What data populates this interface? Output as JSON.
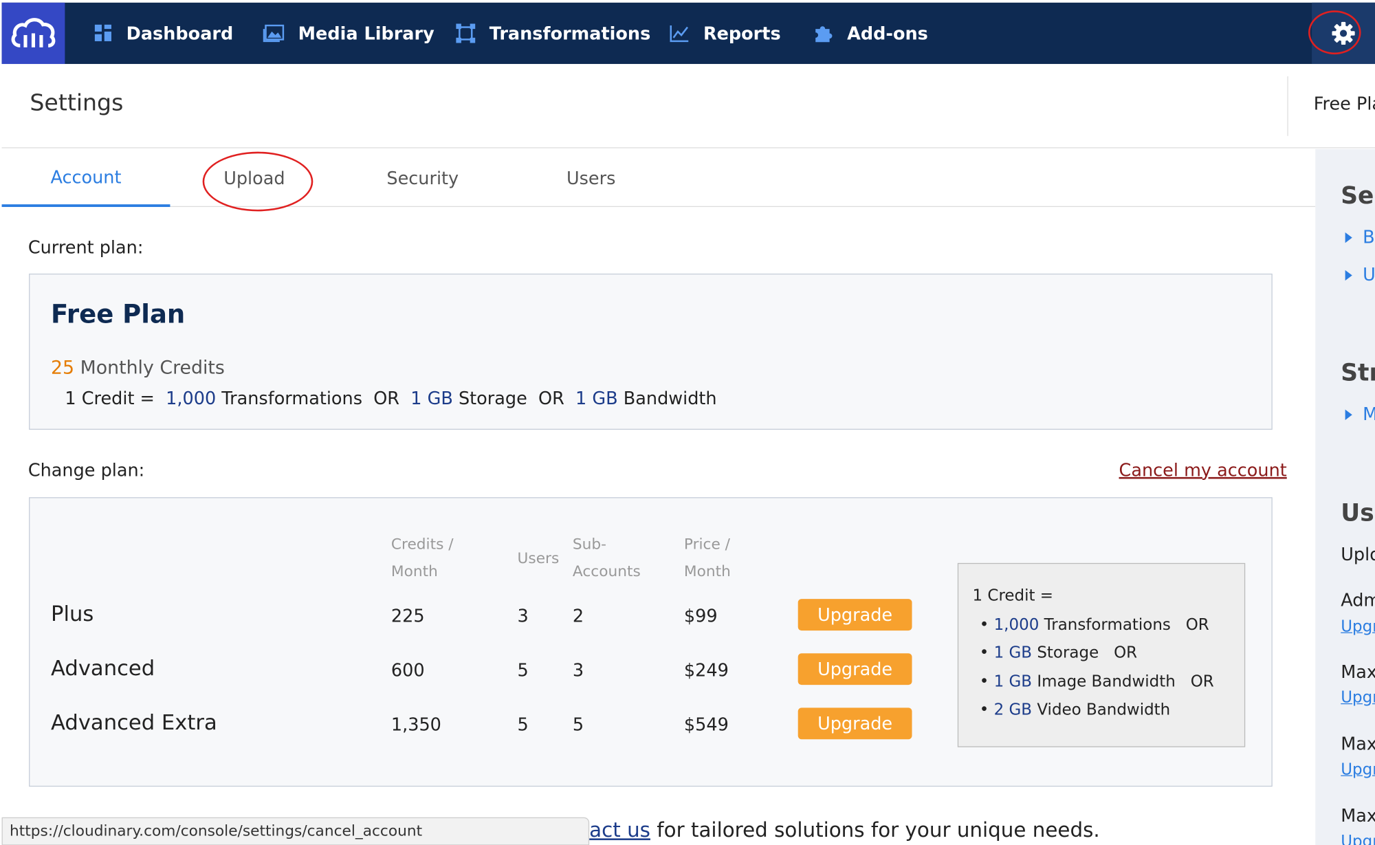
{
  "nav": {
    "items": [
      {
        "label": "Dashboard",
        "icon": "grid-icon"
      },
      {
        "label": "Media Library",
        "icon": "image-icon"
      },
      {
        "label": "Transformations",
        "icon": "crop-icon"
      },
      {
        "label": "Reports",
        "icon": "chart-icon"
      },
      {
        "label": "Add-ons",
        "icon": "puzzle-icon"
      }
    ],
    "settings_icon": "gear-icon"
  },
  "header": {
    "title": "Settings",
    "plan_label": "Free Pla"
  },
  "tabs": [
    "Account",
    "Upload",
    "Security",
    "Users"
  ],
  "current_plan": {
    "section_label": "Current plan:",
    "name": "Free Plan",
    "credits_value": "25",
    "credits_label": "Monthly Credits",
    "eq_prefix": "1 Credit =",
    "eq_trans_value": "1,000",
    "eq_trans_label": "Transformations",
    "or": "OR",
    "eq_storage_value": "1 GB",
    "eq_storage_label": "Storage",
    "eq_bw_value": "1 GB",
    "eq_bw_label": "Bandwidth"
  },
  "change_plan": {
    "section_label": "Change plan:",
    "cancel_link": "Cancel my account",
    "headers": {
      "credits": [
        "Credits /",
        "Month"
      ],
      "users": "Users",
      "subaccounts": [
        "Sub-",
        "Accounts"
      ],
      "price": [
        "Price /",
        "Month"
      ]
    },
    "rows": [
      {
        "name": "Plus",
        "credits": "225",
        "users": "3",
        "subaccounts": "2",
        "price": "$99",
        "button": "Upgrade"
      },
      {
        "name": "Advanced",
        "credits": "600",
        "users": "5",
        "subaccounts": "3",
        "price": "$249",
        "button": "Upgrade"
      },
      {
        "name": "Advanced Extra",
        "credits": "1,350",
        "users": "5",
        "subaccounts": "5",
        "price": "$549",
        "button": "Upgrade"
      }
    ],
    "credit_box": {
      "title": "1 Credit =",
      "items": [
        {
          "value": "1,000",
          "label": "Transformations",
          "suffix": "OR"
        },
        {
          "value": "1 GB",
          "label": "Storage",
          "suffix": "OR"
        },
        {
          "value": "1 GB",
          "label": "Image Bandwidth",
          "suffix": "OR"
        },
        {
          "value": "2 GB",
          "label": "Video Bandwidth",
          "suffix": ""
        }
      ]
    }
  },
  "right_panel": {
    "heading1": "Sel",
    "links1": [
      "B",
      "U"
    ],
    "heading2": "Str",
    "links2": [
      "M"
    ],
    "heading3": "Usa",
    "items": [
      {
        "label": "Uplo",
        "link": ""
      },
      {
        "label": "Adm",
        "link": "Upgr"
      },
      {
        "label": "Max",
        "link": "Upgr"
      },
      {
        "label": "Max",
        "link": "Upgr"
      },
      {
        "label": "Max",
        "link": "Upgr"
      }
    ]
  },
  "status_bar_url": "https://cloudinary.com/console/settings/cancel_account",
  "footer": {
    "link": "act us",
    "text": " for tailored solutions for your unique needs."
  },
  "colors": {
    "nav_bg": "#0e2a52",
    "logo_bg": "#3448c5",
    "accent_blue": "#2b7de1",
    "upgrade_orange": "#f7a12e",
    "highlight_red": "#e02020"
  }
}
